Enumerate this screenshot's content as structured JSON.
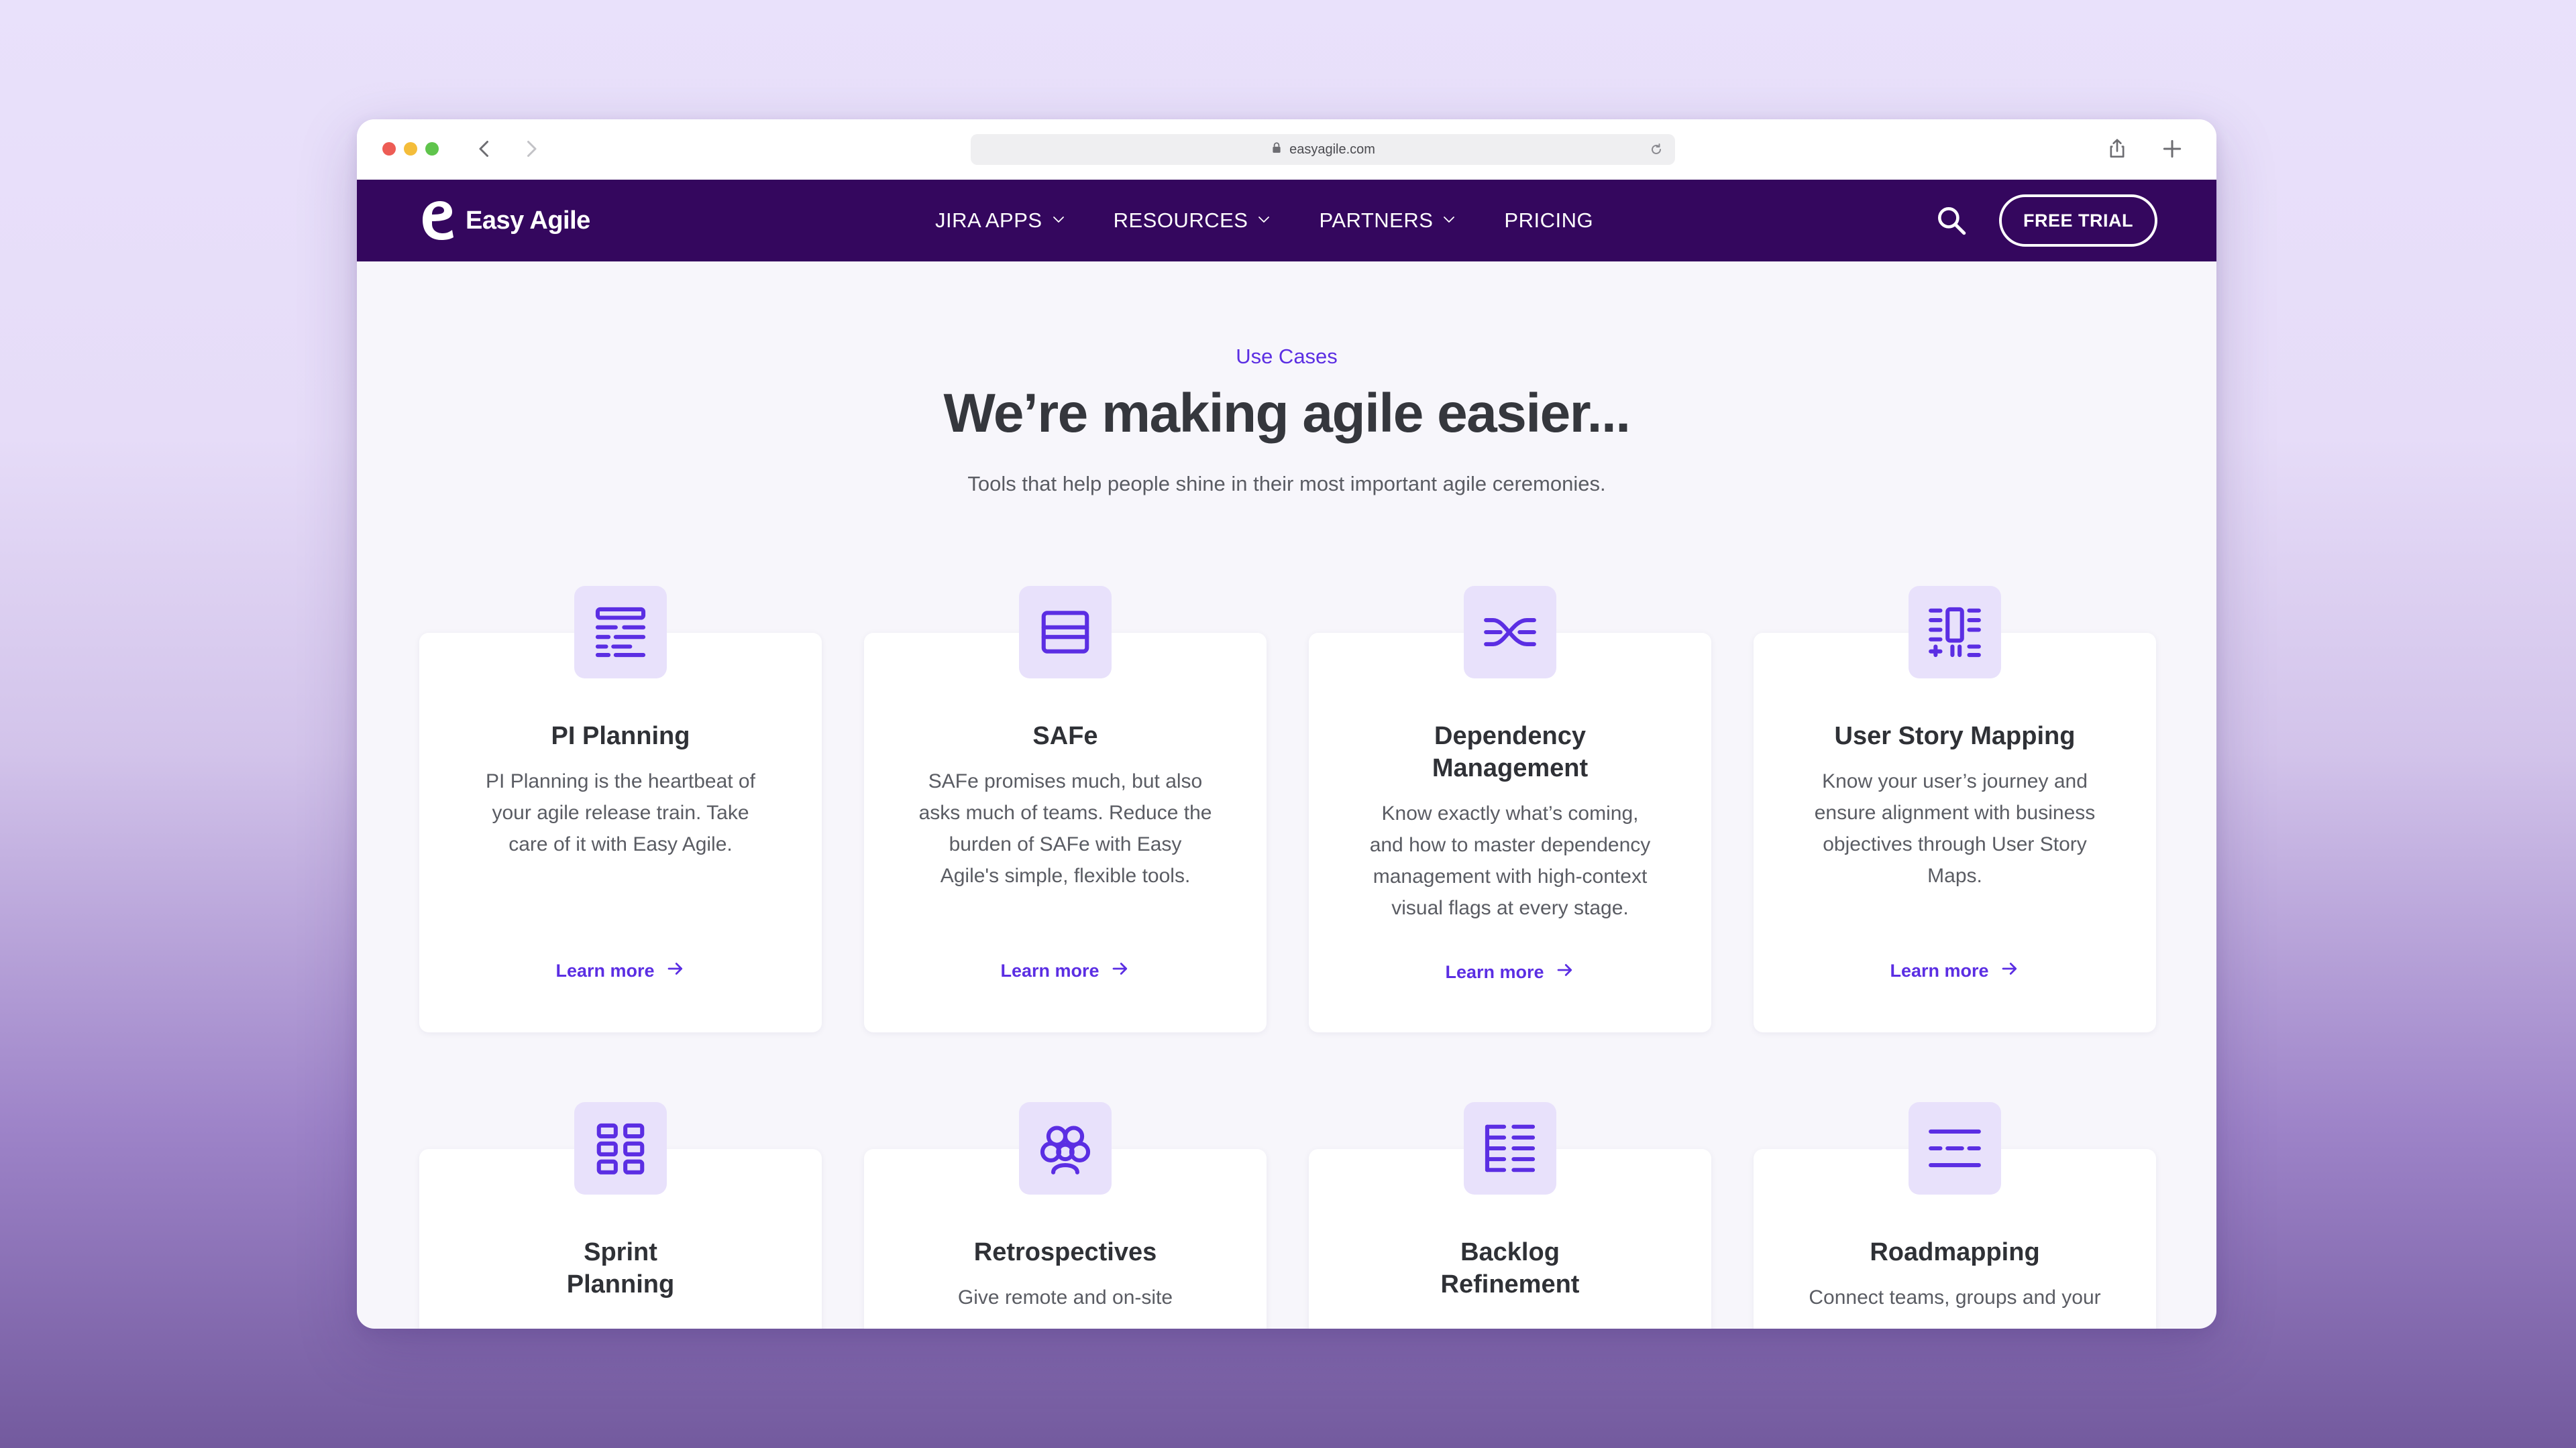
{
  "browser": {
    "url": "easyagile.com"
  },
  "nav": {
    "brand": "Easy Agile",
    "menu": [
      {
        "label": "JIRA APPS",
        "has_dropdown": true
      },
      {
        "label": "RESOURCES",
        "has_dropdown": true
      },
      {
        "label": "PARTNERS",
        "has_dropdown": true
      },
      {
        "label": "PRICING",
        "has_dropdown": false
      }
    ],
    "cta": "FREE TRIAL"
  },
  "hero": {
    "eyebrow": "Use Cases",
    "title": "We’re making agile easier...",
    "subtitle": "Tools that help people shine in their most important agile ceremonies."
  },
  "cards": [
    {
      "icon": "pi-planning-icon",
      "title_lines": [
        "PI Planning"
      ],
      "desc_lines": [
        "PI Planning is the heartbeat of",
        "your agile release train. Take",
        "care of it with Easy Agile."
      ],
      "link": "Learn more"
    },
    {
      "icon": "safe-icon",
      "title_lines": [
        "SAFe"
      ],
      "desc_lines": [
        "SAFe promises much, but also",
        "asks much of teams. Reduce the",
        "burden of SAFe with Easy",
        "Agile's simple, flexible tools."
      ],
      "link": "Learn more"
    },
    {
      "icon": "dependency-icon",
      "title_lines": [
        "Dependency",
        "Management"
      ],
      "desc_lines": [
        "Know exactly what’s coming,",
        "and how to master dependency",
        "management with high-context",
        "visual flags at every stage."
      ],
      "link": "Learn more"
    },
    {
      "icon": "story-map-icon",
      "title_lines": [
        "User Story Mapping"
      ],
      "desc_lines": [
        "Know your user’s journey and",
        "ensure alignment with business",
        "objectives through User Story",
        "Maps."
      ],
      "link": "Learn more"
    },
    {
      "icon": "sprint-grid-icon",
      "title_lines": [
        "Sprint",
        "Planning"
      ],
      "desc_lines": [],
      "link": ""
    },
    {
      "icon": "retrospective-icon",
      "title_lines": [
        "Retrospectives"
      ],
      "desc_lines": [
        "Give remote and on-site"
      ],
      "link": ""
    },
    {
      "icon": "backlog-icon",
      "title_lines": [
        "Backlog",
        "Refinement"
      ],
      "desc_lines": [],
      "link": ""
    },
    {
      "icon": "roadmap-icon",
      "title_lines": [
        "Roadmapping"
      ],
      "desc_lines": [
        "Connect teams, groups and your"
      ],
      "link": ""
    }
  ],
  "colors": {
    "nav_bg": "#34075e",
    "accent": "#5b2ee3",
    "icon_tile": "#e8e1fb"
  }
}
